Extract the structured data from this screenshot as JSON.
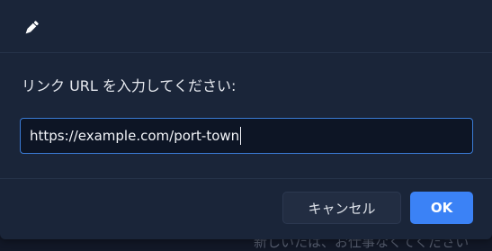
{
  "background": {
    "partial_text": "新しいたは、お仕事なくてください"
  },
  "dialog": {
    "icon": "pencil-icon",
    "prompt": "リンク URL を入力してください:",
    "input": {
      "value": "https://example.com/port-town"
    },
    "buttons": {
      "cancel_label": "キャンセル",
      "ok_label": "OK"
    }
  },
  "colors": {
    "accent": "#3b82f6",
    "dialog_bg": "#1a2539",
    "input_border": "#3a7bd5"
  }
}
